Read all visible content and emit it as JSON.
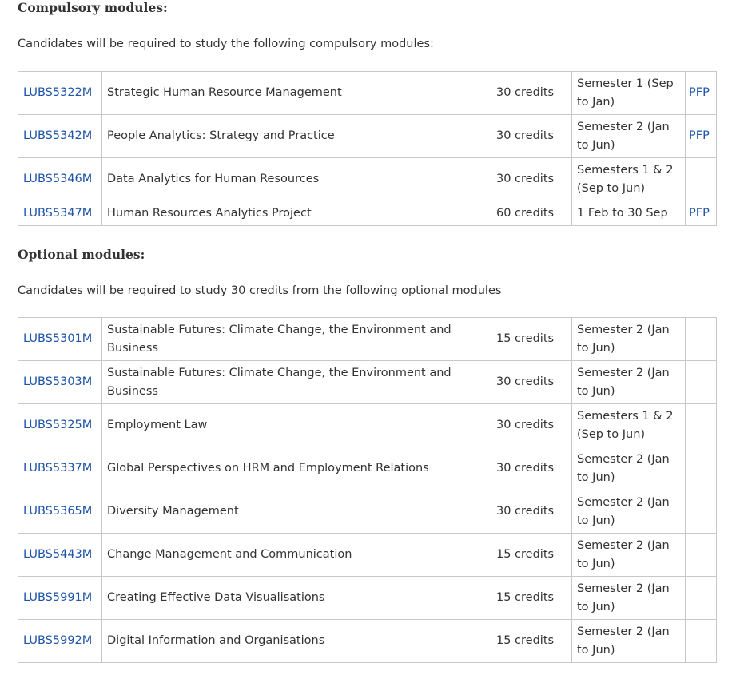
{
  "compulsory": {
    "heading": "Compulsory modules:",
    "intro": "Candidates will be required to study the following compulsory modules:",
    "rows": [
      {
        "code": "LUBS5322M",
        "title": "Strategic Human Resource Management",
        "credits": "30 credits",
        "semester": "Semester 1 (Sep to Jan)",
        "pfp": "PFP"
      },
      {
        "code": "LUBS5342M",
        "title": "People Analytics: Strategy and Practice",
        "credits": "30 credits",
        "semester": "Semester 2 (Jan to Jun)",
        "pfp": "PFP"
      },
      {
        "code": "LUBS5346M",
        "title": "Data Analytics for Human Resources",
        "credits": "30 credits",
        "semester": "Semesters 1 & 2 (Sep to Jun)",
        "pfp": ""
      },
      {
        "code": "LUBS5347M",
        "title": "Human Resources Analytics Project",
        "credits": "60 credits",
        "semester": "1 Feb to 30 Sep",
        "pfp": "PFP"
      }
    ]
  },
  "optional": {
    "heading": "Optional modules:",
    "intro": "Candidates will be required to study 30 credits from the following optional modules",
    "rows": [
      {
        "code": "LUBS5301M",
        "title": "Sustainable Futures: Climate Change, the Environment and Business",
        "credits": "15 credits",
        "semester": "Semester 2 (Jan to Jun)",
        "pfp": ""
      },
      {
        "code": "LUBS5303M",
        "title": "Sustainable Futures: Climate Change, the Environment and Business",
        "credits": "30 credits",
        "semester": "Semester 2 (Jan to Jun)",
        "pfp": ""
      },
      {
        "code": "LUBS5325M",
        "title": "Employment Law",
        "credits": "30 credits",
        "semester": "Semesters 1 & 2 (Sep to Jun)",
        "pfp": ""
      },
      {
        "code": "LUBS5337M",
        "title": "Global Perspectives on HRM and Employment Relations",
        "credits": "30 credits",
        "semester": "Semester 2 (Jan to Jun)",
        "pfp": ""
      },
      {
        "code": "LUBS5365M",
        "title": "Diversity Management",
        "credits": "30 credits",
        "semester": "Semester 2 (Jan to Jun)",
        "pfp": ""
      },
      {
        "code": "LUBS5443M",
        "title": "Change Management and Communication",
        "credits": "15 credits",
        "semester": "Semester 2 (Jan to Jun)",
        "pfp": ""
      },
      {
        "code": "LUBS5991M",
        "title": "Creating Effective Data Visualisations",
        "credits": "15 credits",
        "semester": "Semester 2 (Jan to Jun)",
        "pfp": ""
      },
      {
        "code": "LUBS5992M",
        "title": "Digital Information and Organisations",
        "credits": "15 credits",
        "semester": "Semester 2 (Jan to Jun)",
        "pfp": ""
      }
    ]
  }
}
